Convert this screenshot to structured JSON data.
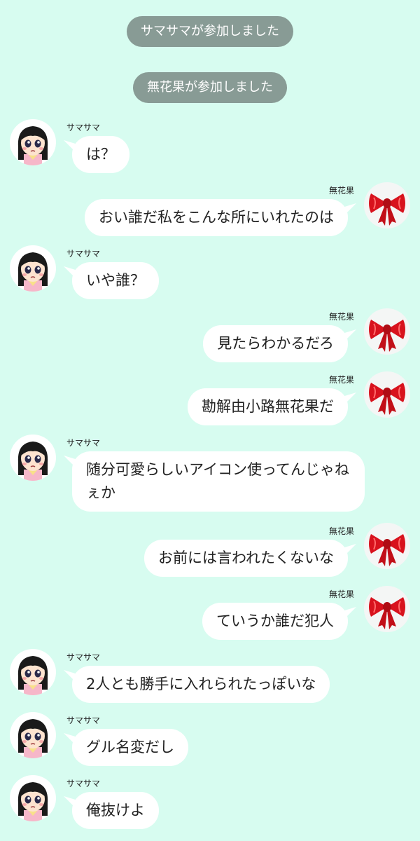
{
  "system_messages": [
    "サマサマが参加しました",
    "無花果が参加しました"
  ],
  "users": {
    "left": {
      "name": "サマサマ",
      "avatar_icon": "girl-avatar-icon"
    },
    "right": {
      "name": "無花果",
      "avatar_icon": "red-ribbon-avatar-icon"
    }
  },
  "messages": [
    {
      "sender": "サマサマ",
      "text": "は？"
    },
    {
      "sender": "無花果",
      "text": "おい誰だ私をこんな所にいれたのは"
    },
    {
      "sender": "サマサマ",
      "text": "いや誰？"
    },
    {
      "sender": "無花果",
      "text": "見たらわかるだろ"
    },
    {
      "sender": "無花果",
      "text": "勘解由小路無花果だ"
    },
    {
      "sender": "サマサマ",
      "text": "随分可愛らしいアイコン使ってんじゃねぇか"
    },
    {
      "sender": "無花果",
      "text": "お前には言われたくないな"
    },
    {
      "sender": "無花果",
      "text": "ていうか誰だ犯人"
    },
    {
      "sender": "サマサマ",
      "text": "2人とも勝手に入れられたっぽいな"
    },
    {
      "sender": "サマサマ",
      "text": "グル名変だし"
    },
    {
      "sender": "サマサマ",
      "text": "俺抜けよ"
    }
  ]
}
